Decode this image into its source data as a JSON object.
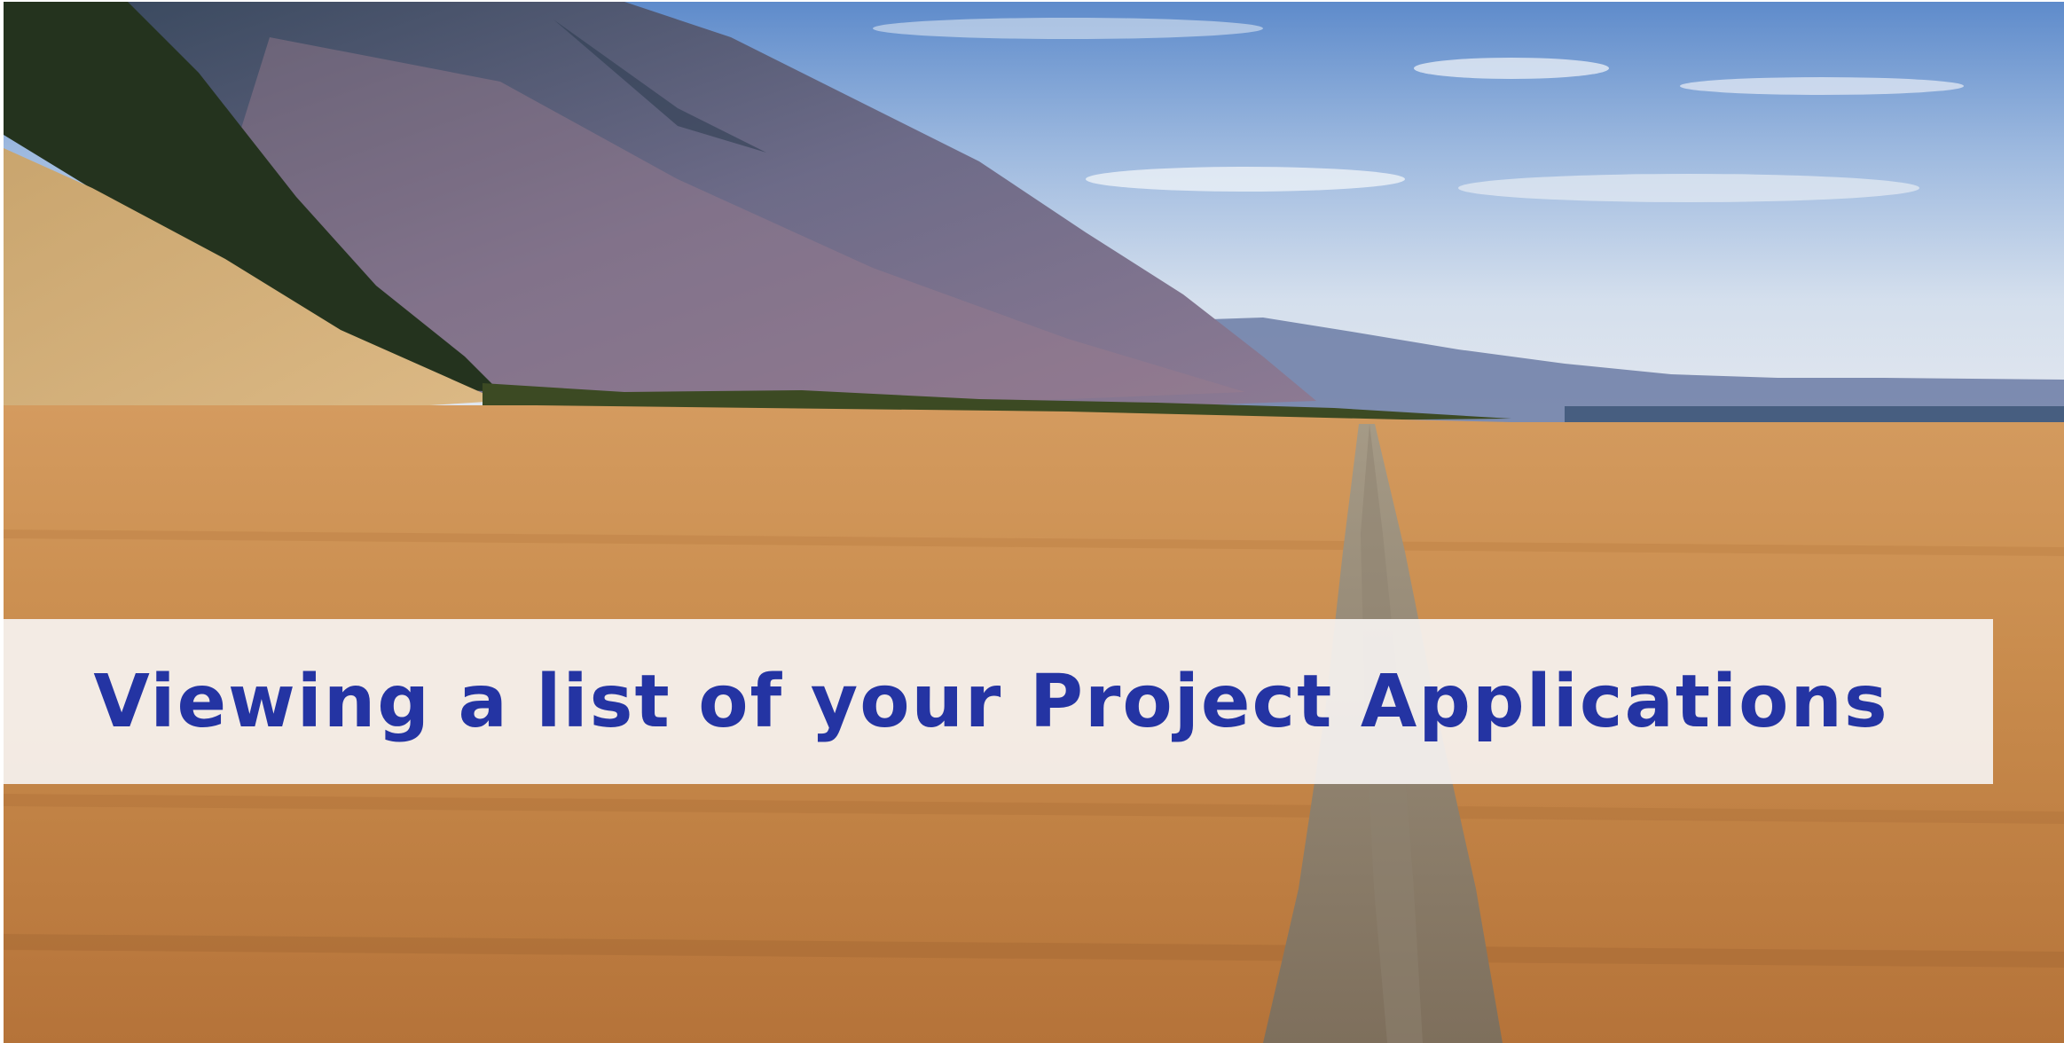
{
  "banner": {
    "title": "Viewing a list of your Project Applications"
  },
  "background": {
    "scene": "landscape-photo"
  },
  "colors": {
    "title_text": "#2434a3",
    "banner_background": "#f6f3f1",
    "sky": "#6f9ad2",
    "grass": "#c58a4c",
    "mountain": "#4d5a7a"
  }
}
